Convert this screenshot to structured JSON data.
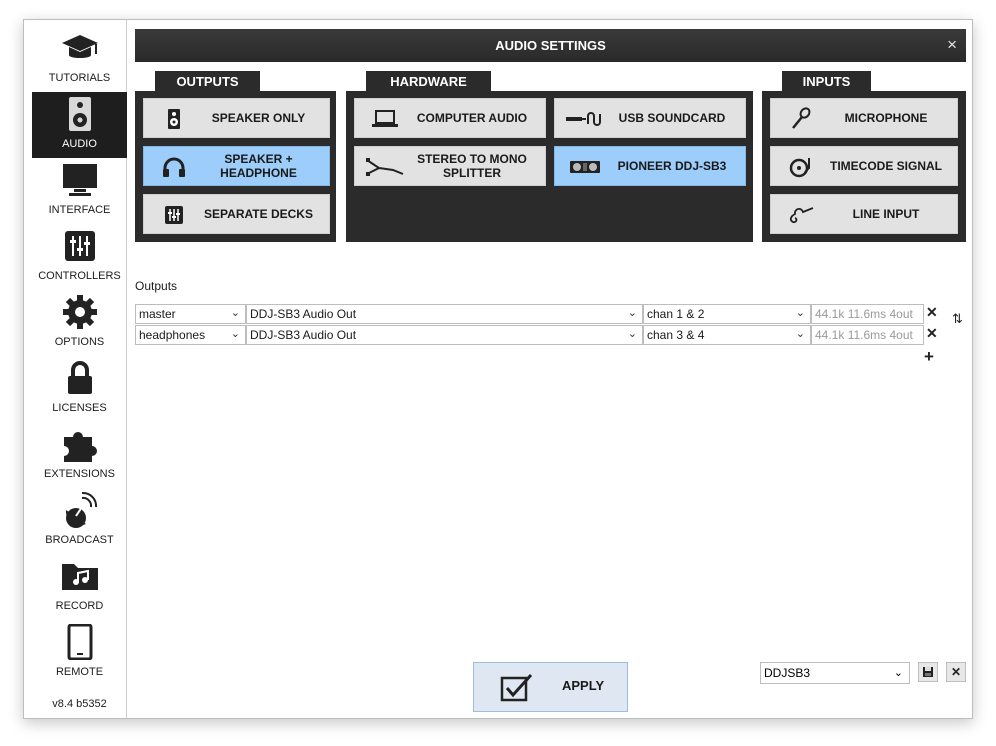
{
  "sidebar": {
    "items": [
      {
        "label": "TUTORIALS",
        "icon": "graduation-cap-icon"
      },
      {
        "label": "AUDIO",
        "icon": "speaker-icon",
        "active": true
      },
      {
        "label": "INTERFACE",
        "icon": "monitor-icon"
      },
      {
        "label": "CONTROLLERS",
        "icon": "sliders-icon"
      },
      {
        "label": "OPTIONS",
        "icon": "gear-icon"
      },
      {
        "label": "LICENSES",
        "icon": "lock-icon"
      },
      {
        "label": "EXTENSIONS",
        "icon": "puzzle-icon"
      },
      {
        "label": "BROADCAST",
        "icon": "satellite-dish-icon"
      },
      {
        "label": "RECORD",
        "icon": "music-folder-icon"
      },
      {
        "label": "REMOTE",
        "icon": "tablet-icon"
      }
    ],
    "version": "v8.4 b5352"
  },
  "header": {
    "title": "AUDIO SETTINGS",
    "close": "×"
  },
  "outputs": {
    "label": "OUTPUTS",
    "speaker_only": "SPEAKER ONLY",
    "speaker_headphone": "SPEAKER + HEADPHONE",
    "separate_decks": "SEPARATE DECKS"
  },
  "hardware": {
    "label": "HARDWARE",
    "computer_audio": "COMPUTER AUDIO",
    "usb_soundcard": "USB SOUNDCARD",
    "stereo_mono": "STEREO TO MONO SPLITTER",
    "pioneer": "PIONEER DDJ-SB3"
  },
  "inputs": {
    "label": "INPUTS",
    "microphone": "MICROPHONE",
    "timecode": "TIMECODE SIGNAL",
    "line_input": "LINE INPUT"
  },
  "outputs_table": {
    "label": "Outputs",
    "rows": [
      {
        "channel": "master",
        "device": "DDJ-SB3 Audio Out",
        "chan": "chan 1 & 2",
        "info": "44.1k 11.6ms 4out"
      },
      {
        "channel": "headphones",
        "device": "DDJ-SB3 Audio Out",
        "chan": "chan 3 & 4",
        "info": "44.1k 11.6ms 4out"
      }
    ],
    "remove": "✕",
    "add": "+",
    "swap": "⇅"
  },
  "footer": {
    "apply": "APPLY",
    "preset": "DDJSB3",
    "delete": "✕"
  },
  "colors": {
    "selected": "#9ccdfb",
    "panel": "#2b2b2b",
    "button": "#e2e2e2"
  }
}
